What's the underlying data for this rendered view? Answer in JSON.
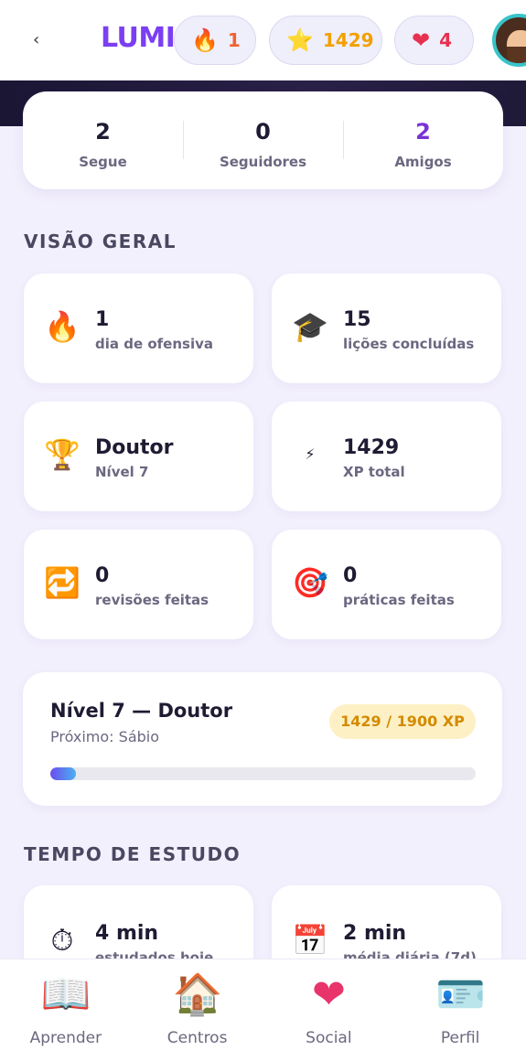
{
  "header": {
    "back_label": "‹",
    "logo": "LUMI",
    "streak": "1",
    "xp": "1429",
    "lives": "4"
  },
  "follow": {
    "items": [
      {
        "value": "2",
        "label": "Segue"
      },
      {
        "value": "0",
        "label": "Seguidores"
      },
      {
        "value": "2",
        "label": "Amigos"
      }
    ]
  },
  "overview": {
    "title": "VISÃO GERAL",
    "stats": [
      {
        "icon": "flame-icon",
        "glyph": "🔥",
        "value": "1",
        "label": "dia de ofensiva"
      },
      {
        "icon": "graduation-cap-icon",
        "glyph": "🎓",
        "value": "15",
        "label": "lições concluídas"
      },
      {
        "icon": "trophy-icon",
        "glyph": "🏆",
        "value": "Doutor",
        "label": "Nível 7"
      },
      {
        "icon": "bolt-icon",
        "glyph": "⚡",
        "value": "1429",
        "label": "XP total"
      },
      {
        "icon": "repeat-icon",
        "glyph": "🔁",
        "value": "0",
        "label": "revisões feitas"
      },
      {
        "icon": "target-icon",
        "glyph": "🎯",
        "value": "0",
        "label": "práticas feitas"
      }
    ]
  },
  "level": {
    "title": "Nível 7 — Doutor",
    "next": "Próximo: Sábio",
    "badge": "1429 / 1900 XP",
    "progress": 0.06
  },
  "study": {
    "title": "TEMPO DE ESTUDO",
    "stats": [
      {
        "icon": "stopwatch-icon",
        "glyph": "⏱",
        "value": "4 min",
        "label": "estudados hoje"
      },
      {
        "icon": "calendar-icon",
        "glyph": "📅",
        "value": "2 min",
        "label": "média diária (7d)"
      }
    ]
  },
  "nav": {
    "items": [
      {
        "icon": "book-lightbulb-icon",
        "glyph": "📖",
        "label": "Aprender"
      },
      {
        "icon": "house-icon",
        "glyph": "🏠",
        "label": "Centros"
      },
      {
        "icon": "heart-icon",
        "glyph": "❤",
        "label": "Social"
      },
      {
        "icon": "profile-cards-icon",
        "glyph": "🪪",
        "label": "Perfil"
      }
    ]
  },
  "colors": {
    "accent": "#7b3ff2",
    "background": "#f3f0fd",
    "streak": "#f0622f",
    "xp": "#f2a000",
    "lives": "#e83150"
  }
}
